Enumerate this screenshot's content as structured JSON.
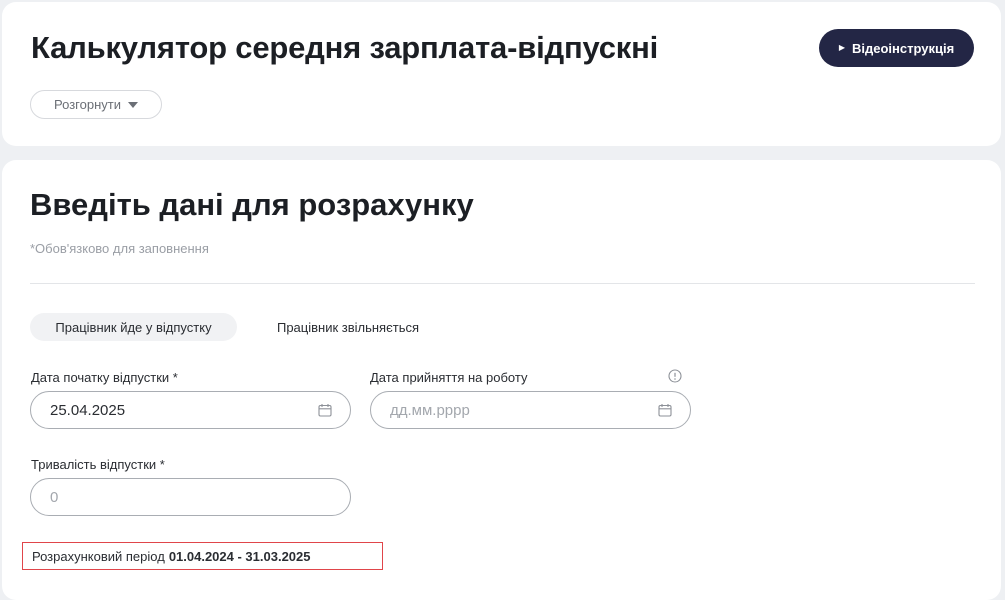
{
  "header": {
    "title": "Калькулятор середня зарплата-відпускні",
    "video_button_label": "Відеоінструкція",
    "expand_button_label": "Розгорнути"
  },
  "form": {
    "title": "Введіть дані для розрахунку",
    "required_note": "*Обов'язково для заповнення",
    "tabs": [
      {
        "label": "Працівник йде у відпустку",
        "active": true
      },
      {
        "label": "Працівник звільняється",
        "active": false
      }
    ],
    "fields": {
      "vacation_start": {
        "label": "Дата початку відпустки *",
        "value": "25.04.2025"
      },
      "hire_date": {
        "label": "Дата прийняття на роботу",
        "value": "",
        "placeholder": "дд.мм.рррр"
      },
      "duration": {
        "label": "Тривалість відпустки *",
        "value": "",
        "placeholder": "0"
      }
    },
    "period": {
      "label": "Розрахунковий період",
      "value": "01.04.2024 - 31.03.2025"
    }
  },
  "colors": {
    "accent_button": "#232645",
    "highlight_border": "#e0454a"
  }
}
